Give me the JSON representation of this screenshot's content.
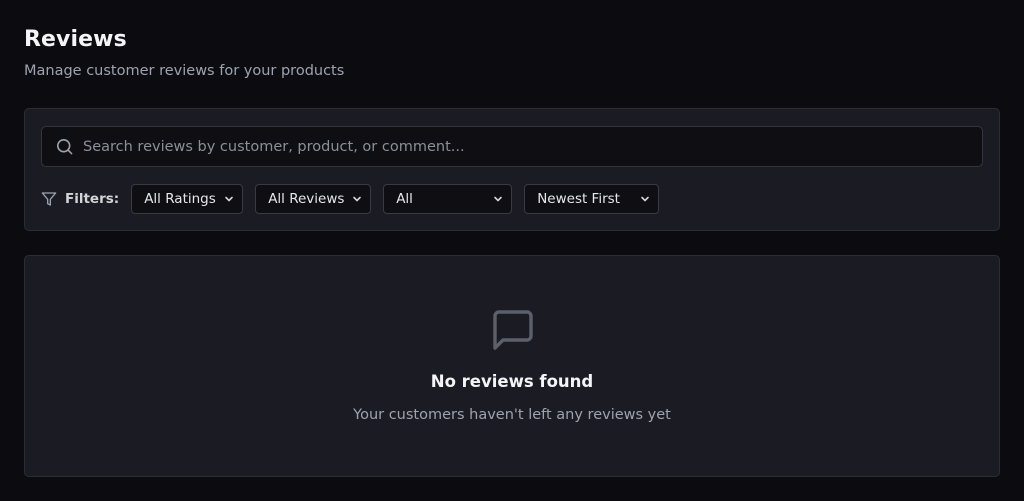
{
  "header": {
    "title": "Reviews",
    "subtitle": "Manage customer reviews for your products"
  },
  "search": {
    "placeholder": "Search reviews by customer, product, or comment...",
    "value": "",
    "icon": "search-icon"
  },
  "filters": {
    "label": "Filters:",
    "icon": "filter-icon",
    "rating": {
      "selected": "All Ratings"
    },
    "reviews": {
      "selected": "All Reviews"
    },
    "status": {
      "selected": "All"
    },
    "sort": {
      "selected": "Newest First"
    }
  },
  "empty_state": {
    "icon": "message-square-icon",
    "title": "No reviews found",
    "message": "Your customers haven't left any reviews yet"
  },
  "colors": {
    "background": "#0c0c10",
    "card": "#1b1b23",
    "border": "#2c2c36",
    "muted_text": "#9ca3af",
    "icon_muted": "#5b606a"
  }
}
